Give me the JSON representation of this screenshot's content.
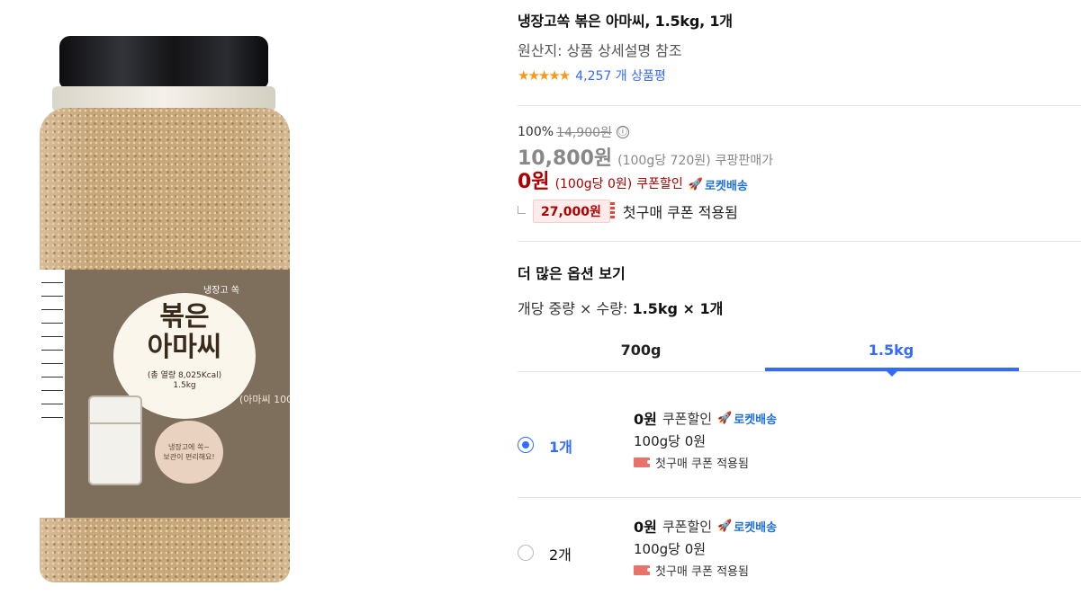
{
  "product": {
    "image": {
      "label_sub": "냉장고 쏙",
      "label_title": "볶은\n아마씨",
      "label_kcal": "(총 열량 8,025Kcal)",
      "label_weight": "1.5kg",
      "label_side": "(아마씨 100",
      "label_note": "냉장고에 쏙~\n보관이 편리해요!"
    },
    "title": "냉장고쏙 볶은 아마씨, 1.5kg, 1개",
    "origin": "원산지: 상품 상세설명 참조",
    "rating": {
      "stars": 4.5,
      "stars_glyph": "★★★★★",
      "count_text": "4,257 개 상품평"
    }
  },
  "pricing": {
    "discount_pct": "100%",
    "original_price": "14,900원",
    "info_icon": "ⓘ",
    "sale_price": "10,800원",
    "sale_unit_price": "(100g당 720원)",
    "seller_type": "쿠팡판매가",
    "coupon_price": "0원",
    "coupon_unit_price": "(100g당 0원)",
    "coupon_label": "쿠폰할인",
    "rocket_icon": "🚀",
    "rocket_label": "로켓배송",
    "first_purchase_amount": "27,000원",
    "first_purchase_text": "첫구매 쿠폰 적용됨"
  },
  "options": {
    "more_title": "더 많은 옵션 보기",
    "selection_prefix": "개당 중량 × 수량: ",
    "selection_value": "1.5kg × 1개",
    "tabs": [
      {
        "label": "700g",
        "selected": false
      },
      {
        "label": "1.5kg",
        "selected": true
      }
    ],
    "items": [
      {
        "qty": "1개",
        "selected": true,
        "price": "0원",
        "coupon": "쿠폰할인",
        "rocket": "로켓배송",
        "unit": "100g당 0원",
        "first": "첫구매 쿠폰 적용됨"
      },
      {
        "qty": "2개",
        "selected": false,
        "price": "0원",
        "coupon": "쿠폰할인",
        "rocket": "로켓배송",
        "unit": "100g당 0원",
        "first": "첫구매 쿠폰 적용됨"
      }
    ]
  },
  "colors": {
    "accent_blue": "#346aff",
    "price_red": "#ae0000",
    "star_orange": "#f39b1a",
    "rocket_blue": "#1d6fd9"
  }
}
